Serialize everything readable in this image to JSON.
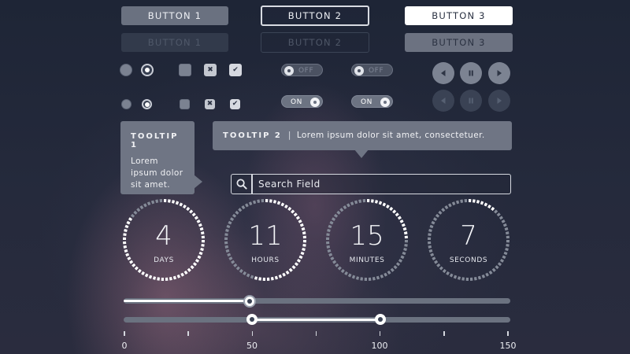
{
  "buttons": {
    "row_active": [
      "BUTTON 1",
      "BUTTON 2",
      "BUTTON 3"
    ],
    "row_disabled": [
      "BUTTON 1",
      "BUTTON 2",
      "BUTTON 3"
    ]
  },
  "toggles": {
    "off_label": "OFF",
    "on_label": "ON"
  },
  "media_icons": [
    "prev-icon",
    "pause-icon",
    "next-icon"
  ],
  "tooltip1": {
    "title": "TOOLTIP 1",
    "text": "Lorem ipsum dolor sit amet."
  },
  "tooltip2": {
    "title": "TOOLTIP 2",
    "separator": "|",
    "text": "Lorem ipsum dolor sit amet, consectetuer."
  },
  "search": {
    "placeholder": "Search Field",
    "icon": "search-icon"
  },
  "countdown": [
    {
      "value": "4",
      "unit": "DAYS",
      "fraction": 0.85
    },
    {
      "value": "11",
      "unit": "HOURS",
      "fraction": 0.55
    },
    {
      "value": "15",
      "unit": "MINUTES",
      "fraction": 0.25
    },
    {
      "value": "7",
      "unit": "SECONDS",
      "fraction": 0.12
    }
  ],
  "slider_single": {
    "min": 0,
    "max": 150,
    "value": 49
  },
  "slider_range": {
    "min": 0,
    "max": 150,
    "low": 50,
    "high": 100
  },
  "scale_labels": [
    "0",
    "50",
    "100",
    "150"
  ],
  "colors": {
    "background": "#1f2638",
    "accent": "#ffffff",
    "muted": "#6b7280"
  }
}
